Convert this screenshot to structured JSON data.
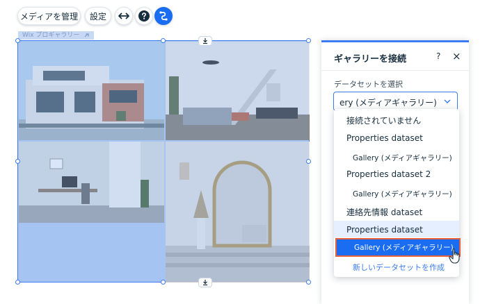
{
  "toolbar": {
    "manage_media_label": "メディアを管理",
    "settings_label": "設定",
    "stretch_icon": "horizontal-arrows-icon",
    "help_icon": "question-circle-icon",
    "connect_icon": "connect-data-icon"
  },
  "element_tag": {
    "label": "Wix プロギャラリー"
  },
  "gallery": {
    "images": [
      "modern-house-exterior",
      "living-room-with-staircase",
      "home-office-desk",
      "bedroom-arched-mirror"
    ]
  },
  "panel": {
    "title": "ギャラリーを接続",
    "help": "?",
    "close": "×",
    "dataset_label": "データセットを選択",
    "selected_value": "ery (メディアギャラリー)"
  },
  "dropdown": {
    "items": [
      {
        "label": "接続されていません"
      },
      {
        "label": "Properties dataset"
      },
      {
        "label": "Gallery (メディアギャラリー)"
      },
      {
        "label": "Properties dataset 2"
      },
      {
        "label": "Gallery (メディアギャラリー)"
      },
      {
        "label": "連絡先情報 dataset"
      },
      {
        "label": "Properties dataset"
      },
      {
        "label": "Gallery (メディアギャラリー)"
      }
    ],
    "create_new": "新しいデータセットを作成"
  },
  "colors": {
    "accent": "#3b7cf0",
    "selected": "#1a6cf0",
    "highlight_border": "#e8603c"
  }
}
